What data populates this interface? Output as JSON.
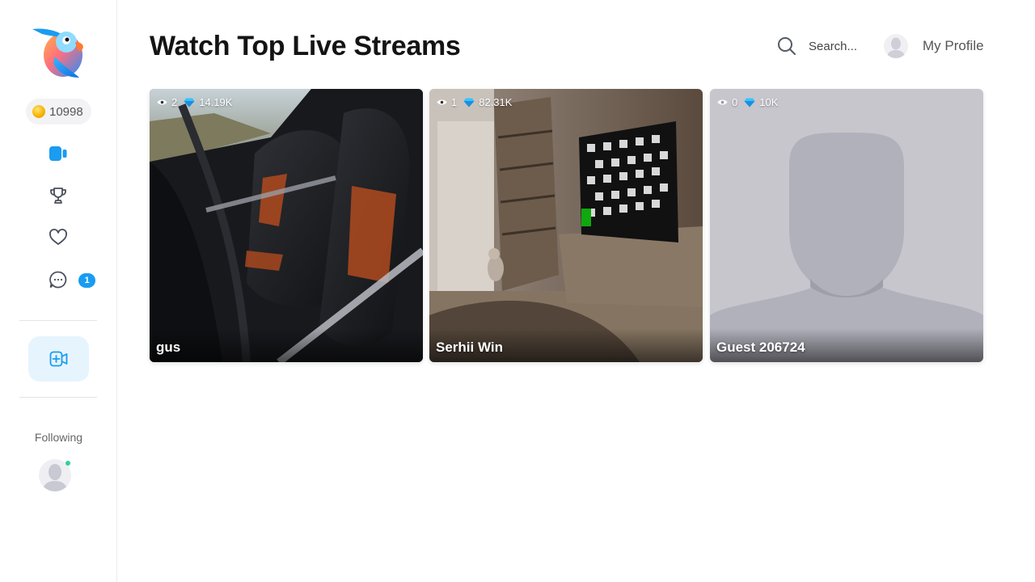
{
  "sidebar": {
    "coins": "10998",
    "nav": [
      {
        "icon": "video-camera-icon",
        "active": true
      },
      {
        "icon": "trophy-icon"
      },
      {
        "icon": "heart-icon"
      },
      {
        "icon": "chat-icon",
        "badge": "1"
      }
    ],
    "go_live_icon": "video-add-icon",
    "following_label": "Following",
    "accent_color": "#1a9cf0"
  },
  "header": {
    "title": "Watch Top Live Streams",
    "search_placeholder": "Search...",
    "profile_label": "My Profile"
  },
  "streams": [
    {
      "viewers": "2",
      "diamonds": "14.19K",
      "name": "gus"
    },
    {
      "viewers": "1",
      "diamonds": "82.31K",
      "name": "Serhii Win"
    },
    {
      "viewers": "0",
      "diamonds": "10K",
      "name": "Guest 206724"
    }
  ]
}
